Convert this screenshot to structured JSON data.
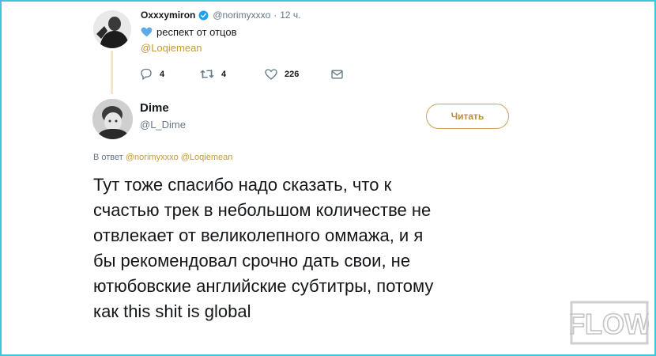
{
  "parent_tweet": {
    "author_name": "Oxxxymiron",
    "handle": "@norimyxxxo",
    "separator": "·",
    "time": "12 ч.",
    "text": "респект от отцов",
    "mention": "@Loqiemean",
    "reply_count": "4",
    "retweet_count": "4",
    "like_count": "226",
    "heart_color": "#5fa9e8",
    "verified_color": "#1da1f2"
  },
  "reply_tweet": {
    "author_name": "Dime",
    "handle": "@L_Dime",
    "follow_label": "Читать",
    "replying_prefix": "В ответ",
    "replying_to_1": "@norimyxxxo",
    "replying_to_2": "@Loqiemean",
    "text": "Тут тоже спасибо надо сказать, что к\nсчастью трек в небольшом количестве не\nотвлекает от великолепного оммажа, и я\nбы рекомендовал срочно дать свои, не\nютюбовские английские субтитры, потому\nкак this shit is global"
  },
  "watermark": {
    "text": "FLOW"
  },
  "colors": {
    "frame": "#3fc7d9",
    "accent": "#c49a3a",
    "thread_line": "#f1e8cc"
  }
}
